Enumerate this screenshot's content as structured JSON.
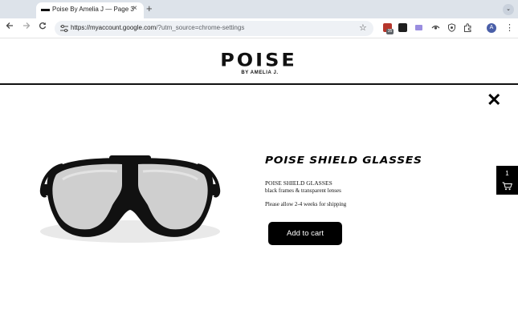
{
  "browser": {
    "tab_title": "Poise By Amelia J — Page 3",
    "tab_close": "×",
    "new_tab": "+",
    "tab_search": "⌄",
    "url_host": "https://myaccount.google.com",
    "url_rest": "/?utm_source=chrome-settings",
    "profile_initial": "A",
    "extension_badge": "35"
  },
  "site": {
    "logo_text": "POISE",
    "logo_subtitle": "BY AMELIA J."
  },
  "product": {
    "heading": "POISE SHIELD GLASSES",
    "name": "POISE SHIELD GLASSES",
    "description": "black frames & transparent lenses",
    "shipping_note": "Please allow 2-4 weeks for shipping",
    "add_to_cart_label": "Add to cart",
    "close_symbol": "✕"
  },
  "cart": {
    "count": "1"
  },
  "icons": {
    "favicon": "poise-favicon-icon",
    "back": "arrow-left-icon",
    "forward": "arrow-right-icon",
    "reload": "reload-icon",
    "site_info": "tune-icon",
    "bookmark": "star-icon",
    "extensions": "puzzle-icon",
    "menu": "kebab-icon",
    "cart": "shopping-cart-icon"
  }
}
